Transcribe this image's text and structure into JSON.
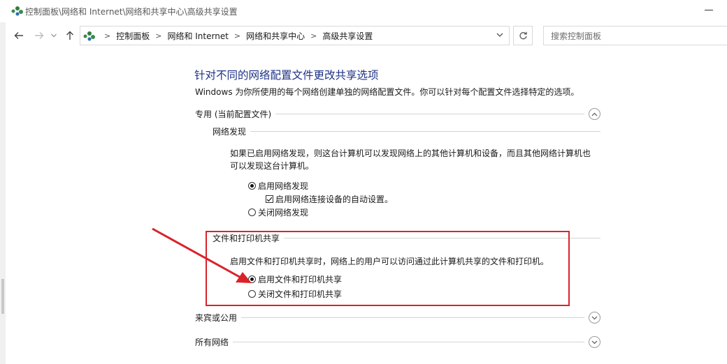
{
  "window": {
    "title": "控制面板\\网络和 Internet\\网络和共享中心\\高级共享设置"
  },
  "nav": {
    "back_icon": "arrow-left-icon",
    "forward_icon": "arrow-right-icon",
    "recent_icon": "chevron-down-icon",
    "up_icon": "arrow-up-icon",
    "breadcrumbs": [
      "控制面板",
      "网络和 Internet",
      "网络和共享中心",
      "高级共享设置"
    ],
    "search_placeholder": "搜索控制面板"
  },
  "content": {
    "title": "针对不同的网络配置文件更改共享选项",
    "description": "Windows 为你所使用的每个网络创建单独的网络配置文件。你可以针对每个配置文件选择特定的选项。",
    "private_profile": {
      "label": "专用 (当前配置文件)",
      "network_discovery": {
        "label": "网络发现",
        "text_line1": "如果已启用网络发现，则这台计算机可以发现网络上的其他计算机和设备，而且其他网络计算机也",
        "text_line2": "可以发现这台计算机。",
        "option_on": "启用网络发现",
        "option_auto": "启用网络连接设备的自动设置。",
        "option_off": "关闭网络发现"
      },
      "file_printer_sharing": {
        "label": "文件和打印机共享",
        "text": "启用文件和打印机共享时，网络上的用户可以访问通过此计算机共享的文件和打印机。",
        "option_on": "启用文件和打印机共享",
        "option_off": "关闭文件和打印机共享"
      }
    },
    "guest_public": {
      "label": "来宾或公用"
    },
    "all_networks": {
      "label": "所有网络"
    }
  },
  "annotation": {
    "color": "#d9232a"
  }
}
